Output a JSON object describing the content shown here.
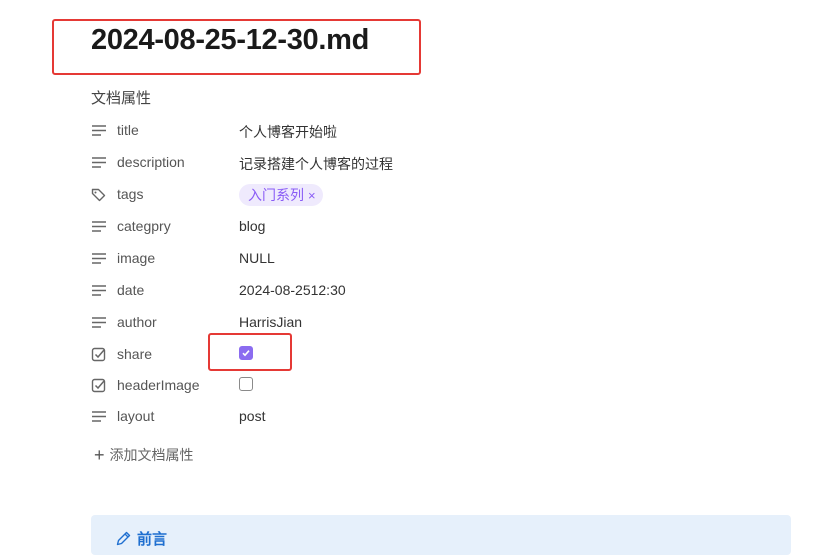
{
  "document": {
    "title": "2024-08-25-12-30.md"
  },
  "properties_header": "文档属性",
  "properties": [
    {
      "key": "title",
      "icon": "text-lines-icon",
      "value": "个人博客开始啦"
    },
    {
      "key": "description",
      "icon": "text-lines-icon",
      "value": "记录搭建个人博客的过程"
    },
    {
      "key": "tags",
      "icon": "tags-icon",
      "tag": "入门系列",
      "tag_remove": "×"
    },
    {
      "key": "categpry",
      "icon": "text-lines-icon",
      "value": "blog"
    },
    {
      "key": "image",
      "icon": "text-lines-icon",
      "value": "NULL"
    },
    {
      "key": "date",
      "icon": "text-lines-icon",
      "value": "2024-08-2512:30"
    },
    {
      "key": "author",
      "icon": "text-lines-icon",
      "value": "HarrisJian"
    },
    {
      "key": "share",
      "icon": "checkbox-icon",
      "checked": true
    },
    {
      "key": "headerImage",
      "icon": "checkbox-icon",
      "checked": false
    },
    {
      "key": "layout",
      "icon": "text-lines-icon",
      "value": "post"
    }
  ],
  "add_property": {
    "icon": "plus-icon",
    "label": "添加文档属性"
  },
  "callout": {
    "icon": "pencil-icon",
    "title": "前言"
  },
  "colors": {
    "highlight": "#e53935",
    "accent": "#8b6cf0",
    "callout_bg": "#e6f0fb",
    "callout_text": "#1f6fd0"
  }
}
